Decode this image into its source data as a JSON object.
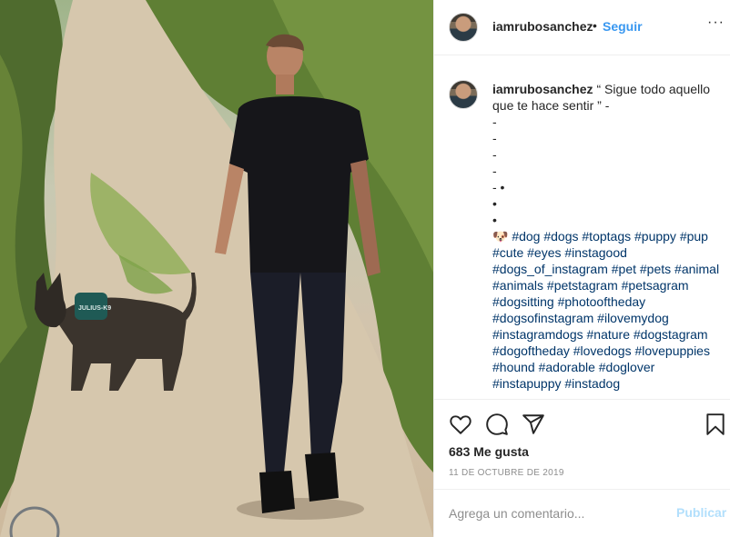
{
  "post": {
    "image_alt": "Hombre caminando con un perro por un sendero"
  },
  "header": {
    "username": "iamrubosanchez",
    "separator": "•",
    "follow_label": "Seguir",
    "more_label": "···"
  },
  "caption": {
    "username": "iamrubosanchez",
    "text": "“ Sigue todo aquello que te hace sentir ” -\n-\n-\n-\n-\n- •\n•\n•",
    "emoji": "🐶",
    "hashtags": "#dog #dogs #toptags #puppy #pup #cute #eyes #instagood #dogs_of_instagram #pet #pets #animal #animals #petstagram #petsagram #dogsitting #photooftheday #dogsofinstagram #ilovemydog #instagramdogs #nature #dogstagram #dogoftheday #lovedogs #lovepuppies #hound #adorable #doglover #instapuppy #instadog"
  },
  "actions": {
    "icons": [
      "heart-icon",
      "comment-icon",
      "share-icon",
      "bookmark-icon"
    ]
  },
  "likes": "683 Me gusta",
  "date": "11 DE OCTUBRE DE 2019",
  "comment": {
    "placeholder": "Agrega un comentario...",
    "post_label": "Publicar"
  },
  "colors": {
    "link": "#3897f0",
    "hashtag": "#003569",
    "muted": "#8e8e8e",
    "post_disabled": "#b2dffc"
  }
}
